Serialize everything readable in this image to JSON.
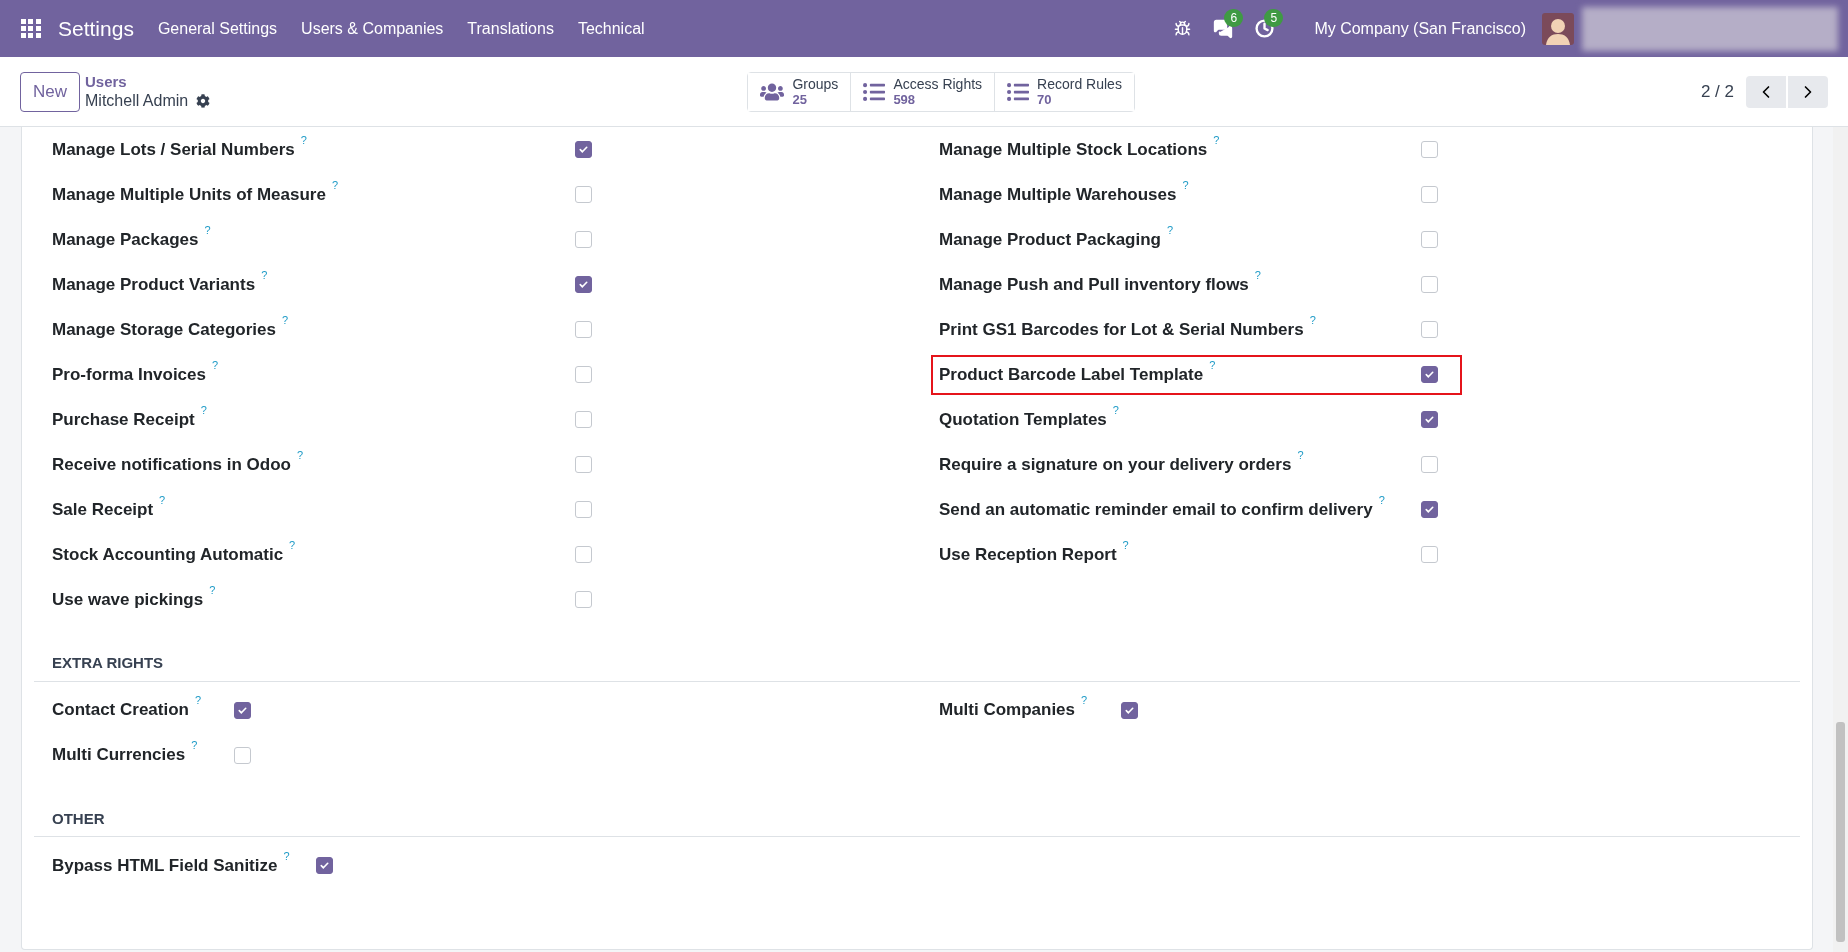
{
  "navbar": {
    "app": "Settings",
    "menus": [
      "General Settings",
      "Users & Companies",
      "Translations",
      "Technical"
    ],
    "messages_badge": "6",
    "activities_badge": "5",
    "company": "My Company (San Francisco)"
  },
  "control_panel": {
    "new_button": "New",
    "breadcrumb": "Users",
    "record": "Mitchell Admin",
    "stat_buttons": [
      {
        "kind": "groups",
        "label": "Groups",
        "value": "25"
      },
      {
        "kind": "list",
        "label": "Access Rights",
        "value": "598"
      },
      {
        "kind": "list",
        "label": "Record Rules",
        "value": "70"
      }
    ],
    "pager": "2 / 2"
  },
  "columns": [
    [
      {
        "label": "Manage Lots / Serial Numbers",
        "help": "?",
        "checked": true,
        "highlighted": false
      },
      {
        "label": "Manage Multiple Units of Measure",
        "help": "?",
        "checked": false,
        "highlighted": false
      },
      {
        "label": "Manage Packages",
        "help": "?",
        "checked": false,
        "highlighted": false
      },
      {
        "label": "Manage Product Variants",
        "help": "?",
        "checked": true,
        "highlighted": false
      },
      {
        "label": "Manage Storage Categories",
        "help": "?",
        "checked": false,
        "highlighted": false
      },
      {
        "label": "Pro-forma Invoices",
        "help": "?",
        "checked": false,
        "highlighted": false
      },
      {
        "label": "Purchase Receipt",
        "help": "?",
        "checked": false,
        "highlighted": false
      },
      {
        "label": "Receive notifications in Odoo",
        "help": "?",
        "checked": false,
        "highlighted": false
      },
      {
        "label": "Sale Receipt",
        "help": "?",
        "checked": false,
        "highlighted": false
      },
      {
        "label": "Stock Accounting Automatic",
        "help": "?",
        "checked": false,
        "highlighted": false
      },
      {
        "label": "Use wave pickings",
        "help": "?",
        "checked": false,
        "highlighted": false
      }
    ],
    [
      {
        "label": "Manage Multiple Stock Locations",
        "help": "?",
        "checked": false,
        "highlighted": false
      },
      {
        "label": "Manage Multiple Warehouses",
        "help": "?",
        "checked": false,
        "highlighted": false
      },
      {
        "label": "Manage Product Packaging",
        "help": "?",
        "checked": false,
        "highlighted": false
      },
      {
        "label": "Manage Push and Pull inventory flows",
        "help": "?",
        "checked": false,
        "highlighted": false
      },
      {
        "label": "Print GS1 Barcodes for Lot & Serial Numbers",
        "help": "?",
        "checked": false,
        "highlighted": false
      },
      {
        "label": "Product Barcode Label Template",
        "help": "?",
        "checked": true,
        "highlighted": true
      },
      {
        "label": "Quotation Templates",
        "help": "?",
        "checked": true,
        "highlighted": false
      },
      {
        "label": "Require a signature on your delivery orders",
        "help": "?",
        "checked": false,
        "highlighted": false
      },
      {
        "label": "Send an automatic reminder email to confirm delivery",
        "help": "?",
        "checked": true,
        "highlighted": false
      },
      {
        "label": "Use Reception Report",
        "help": "?",
        "checked": false,
        "highlighted": false
      }
    ]
  ],
  "sections": [
    {
      "title": "EXTRA RIGHTS",
      "columns": [
        [
          {
            "label": "Contact Creation",
            "help": "?",
            "checked": true
          },
          {
            "label": "Multi Currencies",
            "help": "?",
            "checked": false
          }
        ],
        [
          {
            "label": "Multi Companies",
            "help": "?",
            "checked": true
          }
        ]
      ]
    },
    {
      "title": "OTHER",
      "columns": [
        [
          {
            "label": "Bypass HTML Field Sanitize",
            "help": "?",
            "checked": true
          }
        ]
      ]
    }
  ]
}
